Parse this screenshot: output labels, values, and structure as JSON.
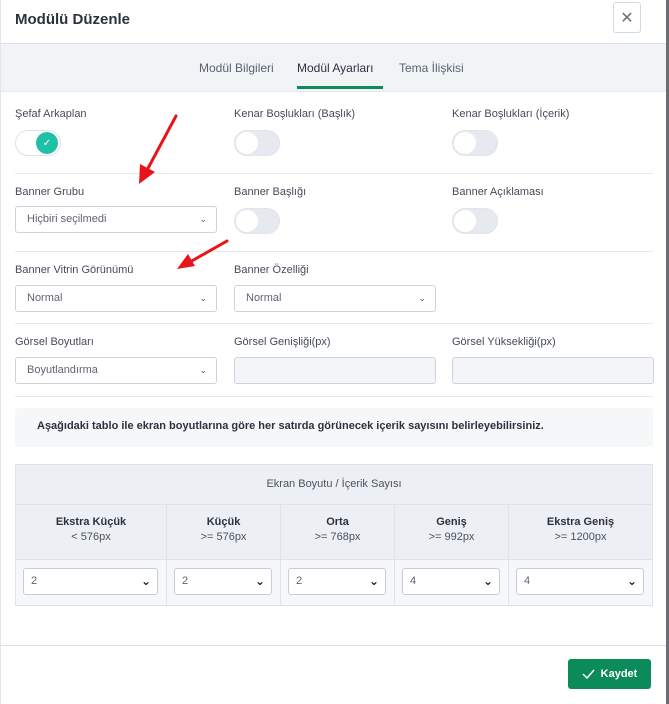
{
  "modal": {
    "title": "Modülü Düzenle",
    "close_icon": "close-icon",
    "close_glyph": "✕"
  },
  "tabs": [
    {
      "label": "Modül Bilgileri",
      "active": false
    },
    {
      "label": "Modül Ayarları",
      "active": true
    },
    {
      "label": "Tema İlişkisi",
      "active": false
    }
  ],
  "toggles": {
    "sefaf_arkaplan": {
      "label": "Şefaf Arkaplan",
      "on": true
    },
    "kenar_baslik": {
      "label": "Kenar Boşlukları (Başlık)",
      "on": false
    },
    "kenar_icerik": {
      "label": "Kenar Boşlukları (İçerik)",
      "on": false
    },
    "banner_basligi": {
      "label": "Banner Başlığı",
      "on": false
    },
    "banner_aciklamasi": {
      "label": "Banner Açıklaması",
      "on": false
    }
  },
  "selects": {
    "banner_grubu": {
      "label": "Banner Grubu",
      "value": "Hiçbiri seçilmedi"
    },
    "banner_vitrin": {
      "label": "Banner Vitrin Görünümü",
      "value": "Normal"
    },
    "banner_ozelligi": {
      "label": "Banner Özelliği",
      "value": "Normal"
    },
    "gorsel_boyutlari": {
      "label": "Görsel Boyutları",
      "value": "Boyutlandırma"
    }
  },
  "inputs": {
    "gorsel_genisligi": {
      "label": "Görsel Genişliği(px)",
      "value": ""
    },
    "gorsel_yuksekligi": {
      "label": "Görsel Yüksekliği(px)",
      "value": ""
    }
  },
  "info_text": "Aşağıdaki tablo ile ekran boyutlarına göre her satırda görünecek içerik sayısını belirleyebilirsiniz.",
  "table": {
    "title": "Ekran Boyutu / İçerik Sayısı",
    "columns": [
      {
        "name": "Ekstra Küçük",
        "size": "< 576px",
        "value": "2"
      },
      {
        "name": "Küçük",
        "size": ">= 576px",
        "value": "2"
      },
      {
        "name": "Orta",
        "size": ">= 768px",
        "value": "2"
      },
      {
        "name": "Geniş",
        "size": ">= 992px",
        "value": "4"
      },
      {
        "name": "Ekstra Geniş",
        "size": ">= 1200px",
        "value": "4"
      }
    ]
  },
  "footer": {
    "save_label": "Kaydet",
    "save_icon": "check-icon"
  },
  "colors": {
    "accent": "#0b8a5a",
    "toggle_on": "#1fc1a6",
    "annotation_arrow": "#e8141a"
  }
}
